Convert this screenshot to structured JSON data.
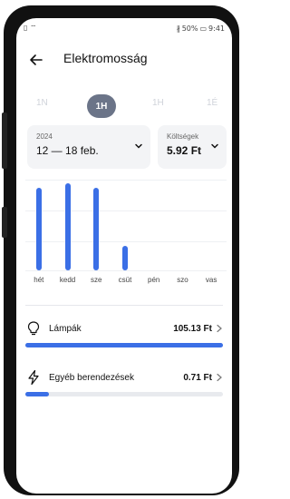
{
  "status_bar": {
    "left_icons": "sim-wifi-icons",
    "battery": "50%",
    "time": "9:41"
  },
  "app": {
    "title": "Elektromosság"
  },
  "period_tabs": [
    {
      "label": "1N",
      "active": false
    },
    {
      "label": "1H",
      "active": true
    },
    {
      "label": "1H",
      "active": false
    },
    {
      "label": "1É",
      "active": false
    }
  ],
  "date_card": {
    "year": "2024",
    "range": "12 — 18 feb."
  },
  "cost_card": {
    "label": "Költségek",
    "value": "5.92 Ft"
  },
  "chart_data": {
    "type": "bar",
    "categories": [
      "hét",
      "kedd",
      "sze",
      "csüt",
      "pén",
      "szo",
      "vas"
    ],
    "values": [
      1.0,
      1.05,
      1.0,
      0.3,
      0,
      0,
      0
    ],
    "color": "#3b6fe6"
  },
  "items": [
    {
      "icon": "lightbulb-icon",
      "label": "Lámpák",
      "value": "105.13 Ft",
      "progress": 1.0
    },
    {
      "icon": "lightning-icon",
      "label": "Egyéb berendezések",
      "value": "0.71 Ft",
      "progress": 0.12
    }
  ],
  "colors": {
    "accent": "#3b6fe6",
    "active_tab": "#6b7488",
    "card_bg": "#f3f4f6"
  }
}
